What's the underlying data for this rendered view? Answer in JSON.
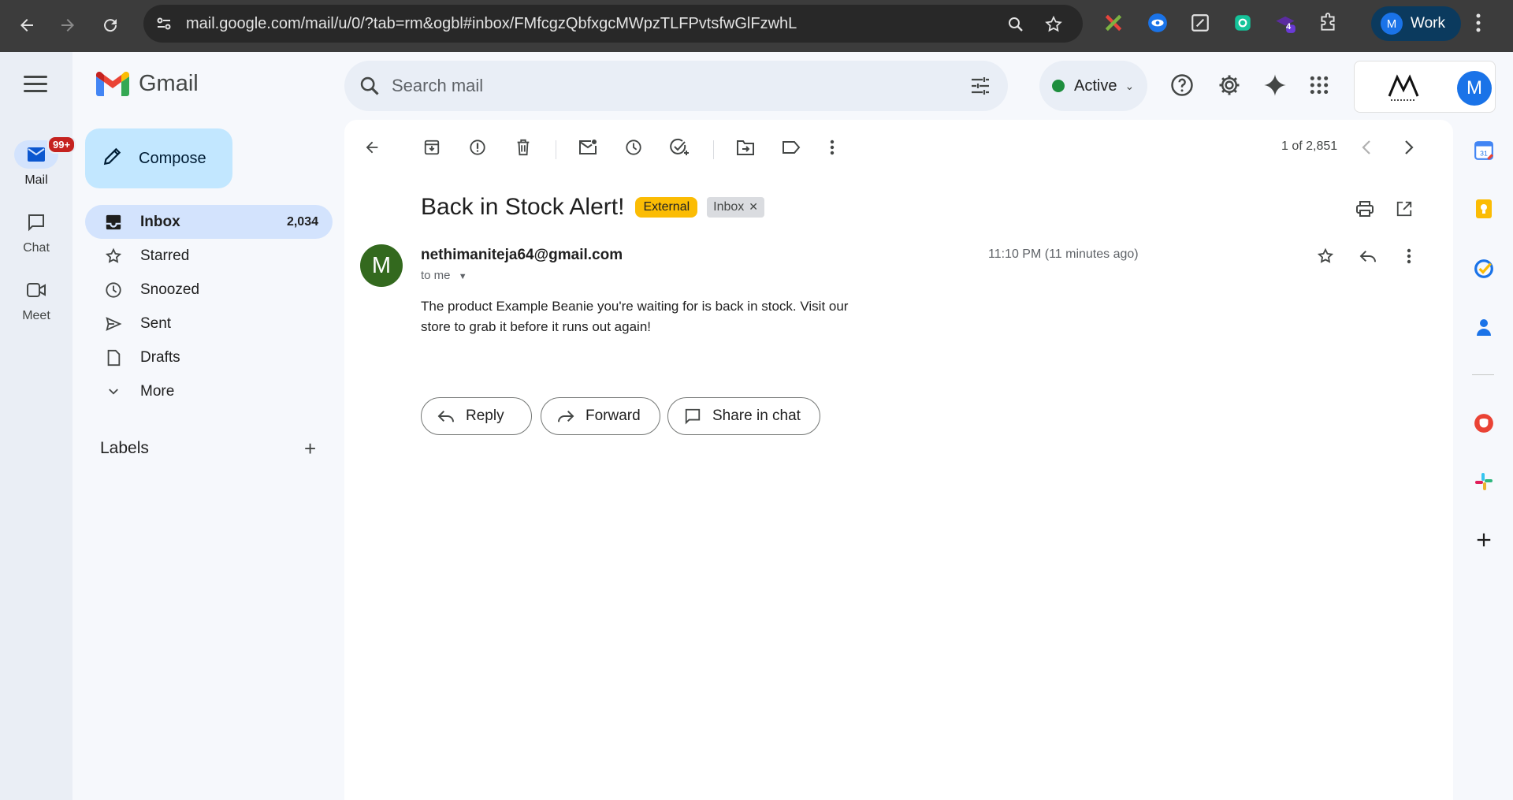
{
  "browser": {
    "url": "mail.google.com/mail/u/0/?tab=rm&ogbl#inbox/FMfcgzQbfxgcMWpzTLFPvtsfwGlFzwhL",
    "profile_label": "Work",
    "profile_initial": "M",
    "extension_badge": "4"
  },
  "rail": {
    "mail_label": "Mail",
    "mail_badge": "99+",
    "chat_label": "Chat",
    "meet_label": "Meet"
  },
  "app": {
    "name": "Gmail"
  },
  "search": {
    "placeholder": "Search mail"
  },
  "status": {
    "label": "Active",
    "color": "#1e8e3e"
  },
  "account": {
    "initial": "M"
  },
  "sidebar": {
    "compose_label": "Compose",
    "items": [
      {
        "label": "Inbox",
        "count": "2,034",
        "icon": "inbox-icon"
      },
      {
        "label": "Starred",
        "icon": "star-icon"
      },
      {
        "label": "Snoozed",
        "icon": "clock-icon"
      },
      {
        "label": "Sent",
        "icon": "send-icon"
      },
      {
        "label": "Drafts",
        "icon": "draft-icon"
      },
      {
        "label": "More",
        "icon": "chevron-down-icon"
      }
    ],
    "labels_heading": "Labels"
  },
  "toolbar": {
    "pager": "1 of 2,851"
  },
  "email": {
    "subject": "Back in Stock Alert!",
    "tag_external": "External",
    "tag_inbox": "Inbox",
    "sender_initial": "M",
    "sender": "nethimaniteja64@gmail.com",
    "to": "to me",
    "time": "11:10 PM (11 minutes ago)",
    "body": "The product Example Beanie you're waiting for is back in stock. Visit our store to grab it before it runs out again!"
  },
  "actions": {
    "reply": "Reply",
    "forward": "Forward",
    "share": "Share in chat"
  },
  "colors": {
    "accent": "#0b57d0",
    "compose_bg": "#c2e7ff",
    "external_tag": "#fbbc04"
  }
}
